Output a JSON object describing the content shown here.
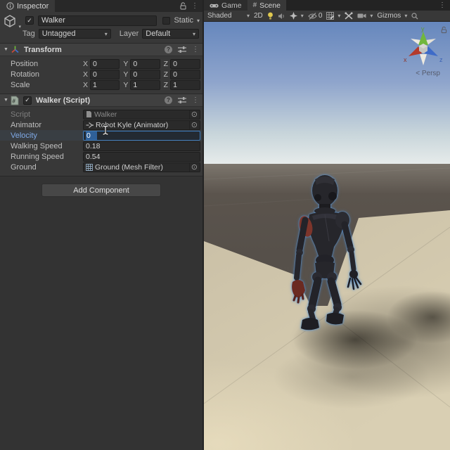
{
  "inspector": {
    "tab_label": "Inspector",
    "header": {
      "name_value": "Walker",
      "static_label": "Static",
      "tag_label": "Tag",
      "tag_value": "Untagged",
      "layer_label": "Layer",
      "layer_value": "Default"
    },
    "axes": [
      "X",
      "Y",
      "Z"
    ],
    "transform": {
      "title": "Transform",
      "rows": [
        {
          "label": "Position",
          "x": "0",
          "y": "0",
          "z": "0"
        },
        {
          "label": "Rotation",
          "x": "0",
          "y": "0",
          "z": "0"
        },
        {
          "label": "Scale",
          "x": "1",
          "y": "1",
          "z": "1"
        }
      ]
    },
    "script_component": {
      "title": "Walker (Script)",
      "rows": [
        {
          "label": "Script",
          "value": "Walker"
        },
        {
          "label": "Animator",
          "value": "Robot Kyle (Animator)"
        },
        {
          "label": "Velocity",
          "value": "0"
        },
        {
          "label": "Walking Speed",
          "value": "0.18"
        },
        {
          "label": "Running Speed",
          "value": "0.54"
        },
        {
          "label": "Ground",
          "value": "Ground (Mesh Filter)"
        }
      ]
    },
    "add_component_label": "Add Component"
  },
  "scene": {
    "game_tab_label": "Game",
    "scene_tab_label": "Scene",
    "toolbar": {
      "shading_mode": "Shaded",
      "mode_2d_label": "2D",
      "hidden_objects_count": "0",
      "gizmos_label": "Gizmos"
    },
    "viewport": {
      "projection_label": "Persp",
      "projection_prefix": "<",
      "axis_x": "x",
      "axis_y": "y",
      "axis_z": "z"
    }
  },
  "icons": {
    "dropdown": "▾",
    "foldout": "▼",
    "kebab": "⋮",
    "check": "✓",
    "picker": "⊙",
    "help": "?",
    "hash": "#"
  },
  "colors": {
    "panel_bg": "#383838",
    "field_bg": "#2A2A2A",
    "focus_border_blue": "#3C79B8",
    "selection_blue": "#2F6099",
    "velocity_label_blue": "#7FA9E6",
    "sky_top": "#6687BD",
    "sky_horizon": "#E9EDEC",
    "ground_far": "#57504A",
    "ground_tan": "#CEC4AA",
    "axis_x_red": "#B43A2C",
    "axis_y_green": "#71B73C",
    "axis_z_blue": "#3E6BC8",
    "robot_red": "#7D352B"
  }
}
